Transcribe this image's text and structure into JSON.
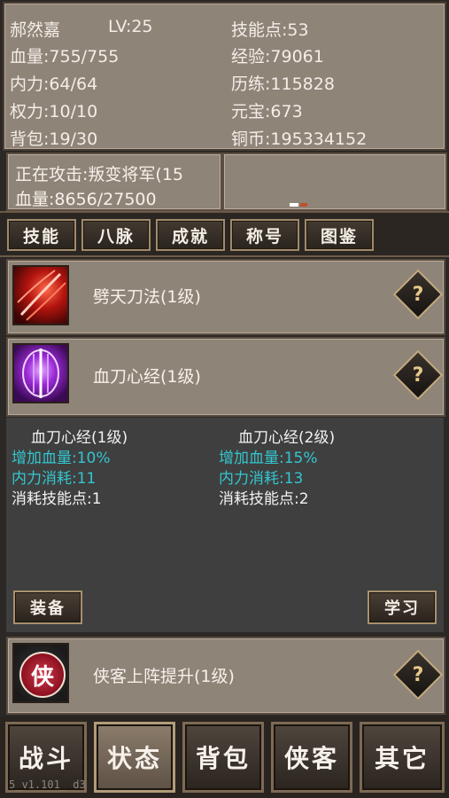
{
  "player": {
    "name": "郝然嘉",
    "level": "LV:25",
    "hp": "血量:755/755",
    "mp": "内力:64/64",
    "power": "权力:10/10",
    "bag": "背包:19/30",
    "skill_points": "技能点:53",
    "exp": "经验:79061",
    "training": "历练:115828",
    "yuanbao": "元宝:673",
    "coins": "铜币:195334152"
  },
  "combat": {
    "attacking": "正在攻击:叛变将军(15",
    "enemy_hp": "血量:8656/27500"
  },
  "tabs": [
    "技能",
    "八脉",
    "成就",
    "称号",
    "图鉴"
  ],
  "skills": [
    {
      "name": "劈天刀法(1级)",
      "icon": "slash-skill-icon",
      "help": "?"
    },
    {
      "name": "血刀心经(1级)",
      "icon": "blade-heart-skill-icon",
      "help": "?"
    },
    {
      "name": "侠客上阵提升(1级)",
      "icon": "hero-skill-icon",
      "icon_text": "侠",
      "help": "?"
    }
  ],
  "skill_detail": {
    "current": {
      "title": "血刀心经(1级)",
      "hp_bonus": "增加血量:10%",
      "mp_cost": "内力消耗:11",
      "sp_cost": "消耗技能点:1"
    },
    "next": {
      "title": "血刀心经(2级)",
      "hp_bonus": "增加血量:15%",
      "mp_cost": "内力消耗:13",
      "sp_cost": "消耗技能点:2"
    },
    "equip_label": "装备",
    "learn_label": "学习"
  },
  "bottom_nav": [
    "战斗",
    "状态",
    "背包",
    "侠客",
    "其它"
  ],
  "active_nav_index": 1,
  "version": "5_v1.101_     d3",
  "colors": {
    "panel": "#8f8478",
    "detail_bg": "#3f3f3f",
    "cyan_text": "#33c6cf",
    "gold_border": "#c0a87e"
  }
}
